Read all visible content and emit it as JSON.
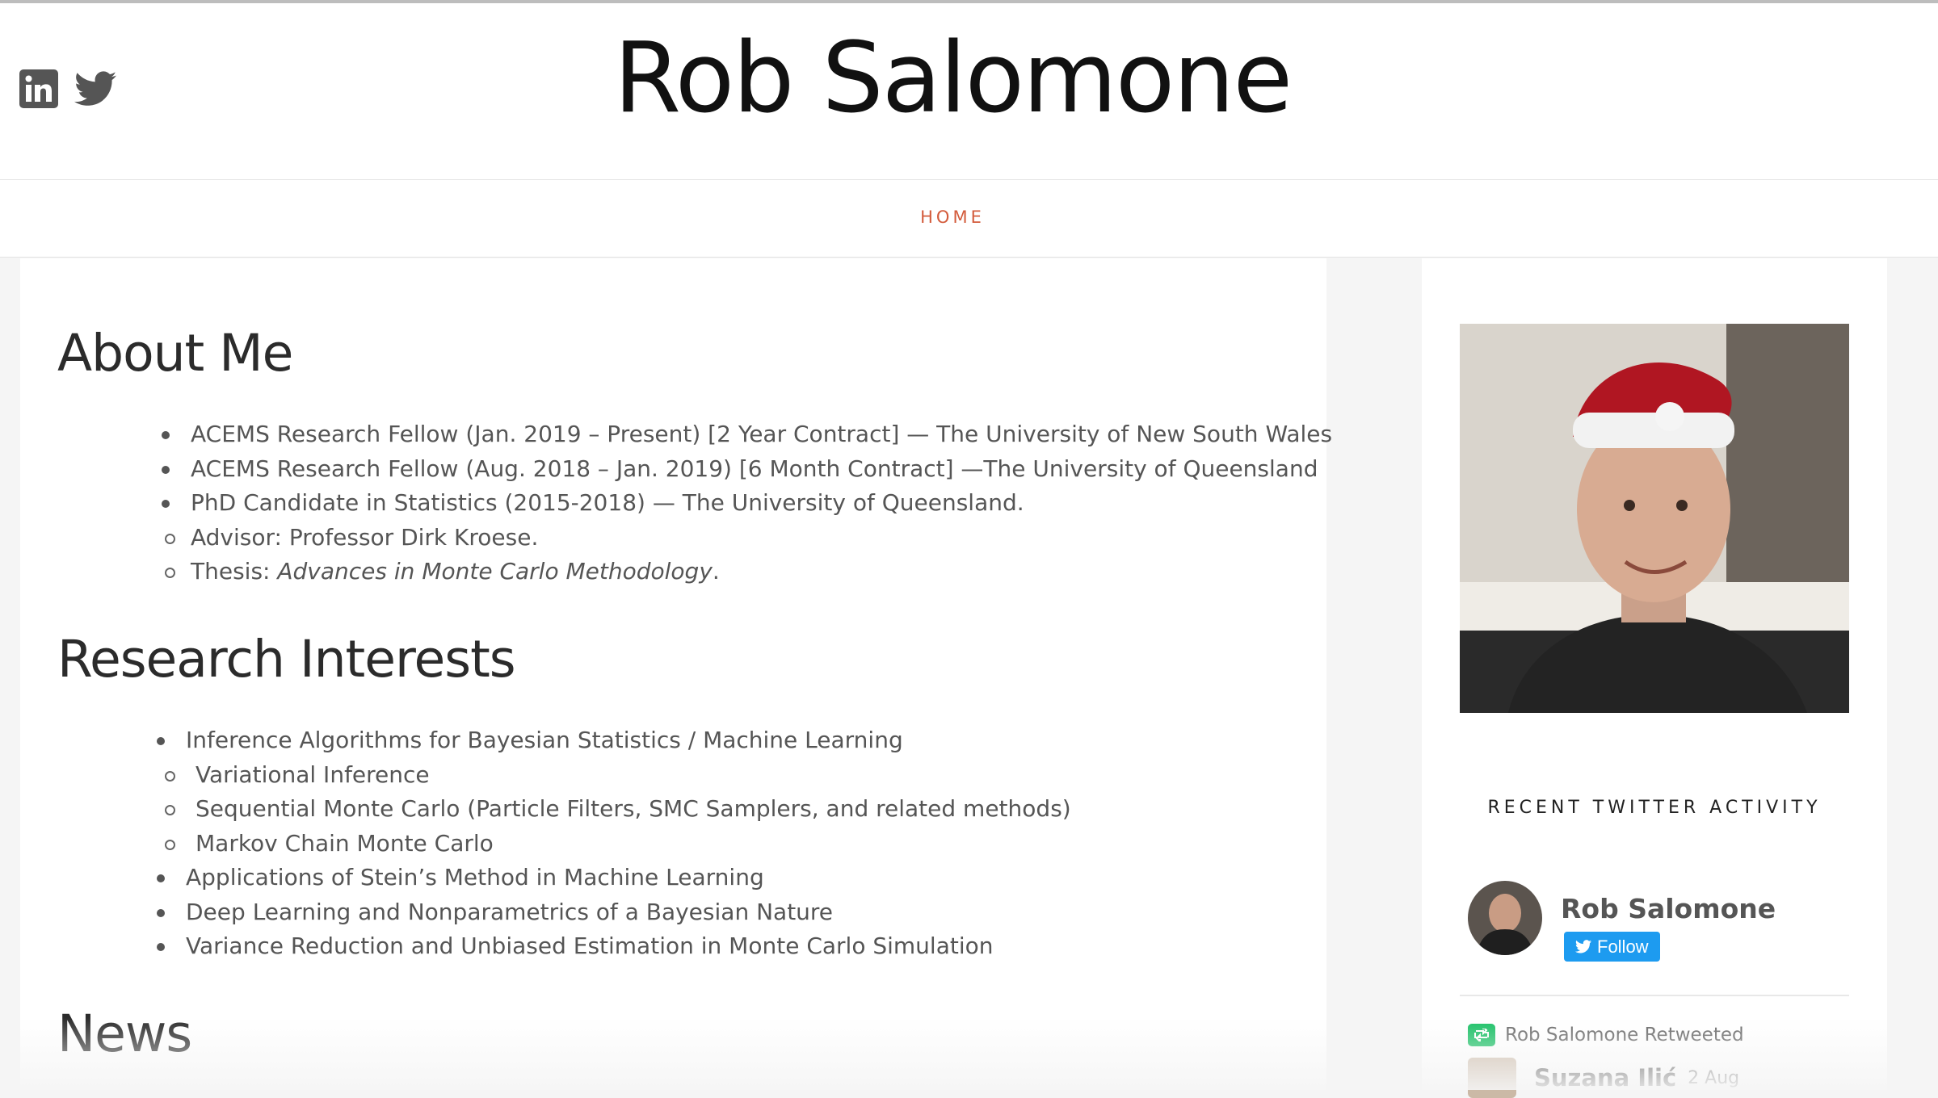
{
  "header": {
    "site_title": "Rob Salomone",
    "social": [
      {
        "icon": "linkedin-icon"
      },
      {
        "icon": "twitter-icon"
      }
    ]
  },
  "nav": {
    "home_label": "HOME"
  },
  "main": {
    "about": {
      "heading": "About Me",
      "items": [
        "ACEMS Research Fellow (Jan. 2019 – Present) [2 Year Contract] — The University of New South Wales",
        "ACEMS Research Fellow (Aug. 2018 – Jan. 2019) [6 Month Contract] —The University of Queensland",
        "PhD Candidate in Statistics (2015-2018) — The University of Queensland."
      ],
      "sub_items": {
        "advisor": "Advisor: Professor Dirk Kroese.",
        "thesis_prefix": "Thesis: ",
        "thesis_title": "Advances in Monte Carlo Methodology",
        "thesis_suffix": "."
      }
    },
    "research": {
      "heading": "Research Interests",
      "items": [
        "Inference Algorithms for Bayesian Statistics / Machine Learning",
        "Variational Inference",
        "Sequential Monte Carlo (Particle Filters, SMC Samplers, and related methods)",
        "Markov Chain Monte Carlo",
        "Applications of Stein’s Method in Machine Learning",
        "Deep Learning and Nonparametrics of a Bayesian Nature",
        "Variance Reduction and Unbiased Estimation  in Monte Carlo Simulation"
      ]
    },
    "news": {
      "heading": "News"
    }
  },
  "sidebar": {
    "widget_title": "RECENT TWITTER ACTIVITY",
    "twitter": {
      "name": "Rob Salomone",
      "follow_label": "Follow",
      "retweet_label": "Rob Salomone Retweeted",
      "next_author": "Suzana Ilić",
      "next_date": "2 Aug"
    }
  },
  "colors": {
    "accent": "#d35b3b",
    "twitter_blue": "#1d9bf0",
    "retweet_green": "#17bf63"
  }
}
